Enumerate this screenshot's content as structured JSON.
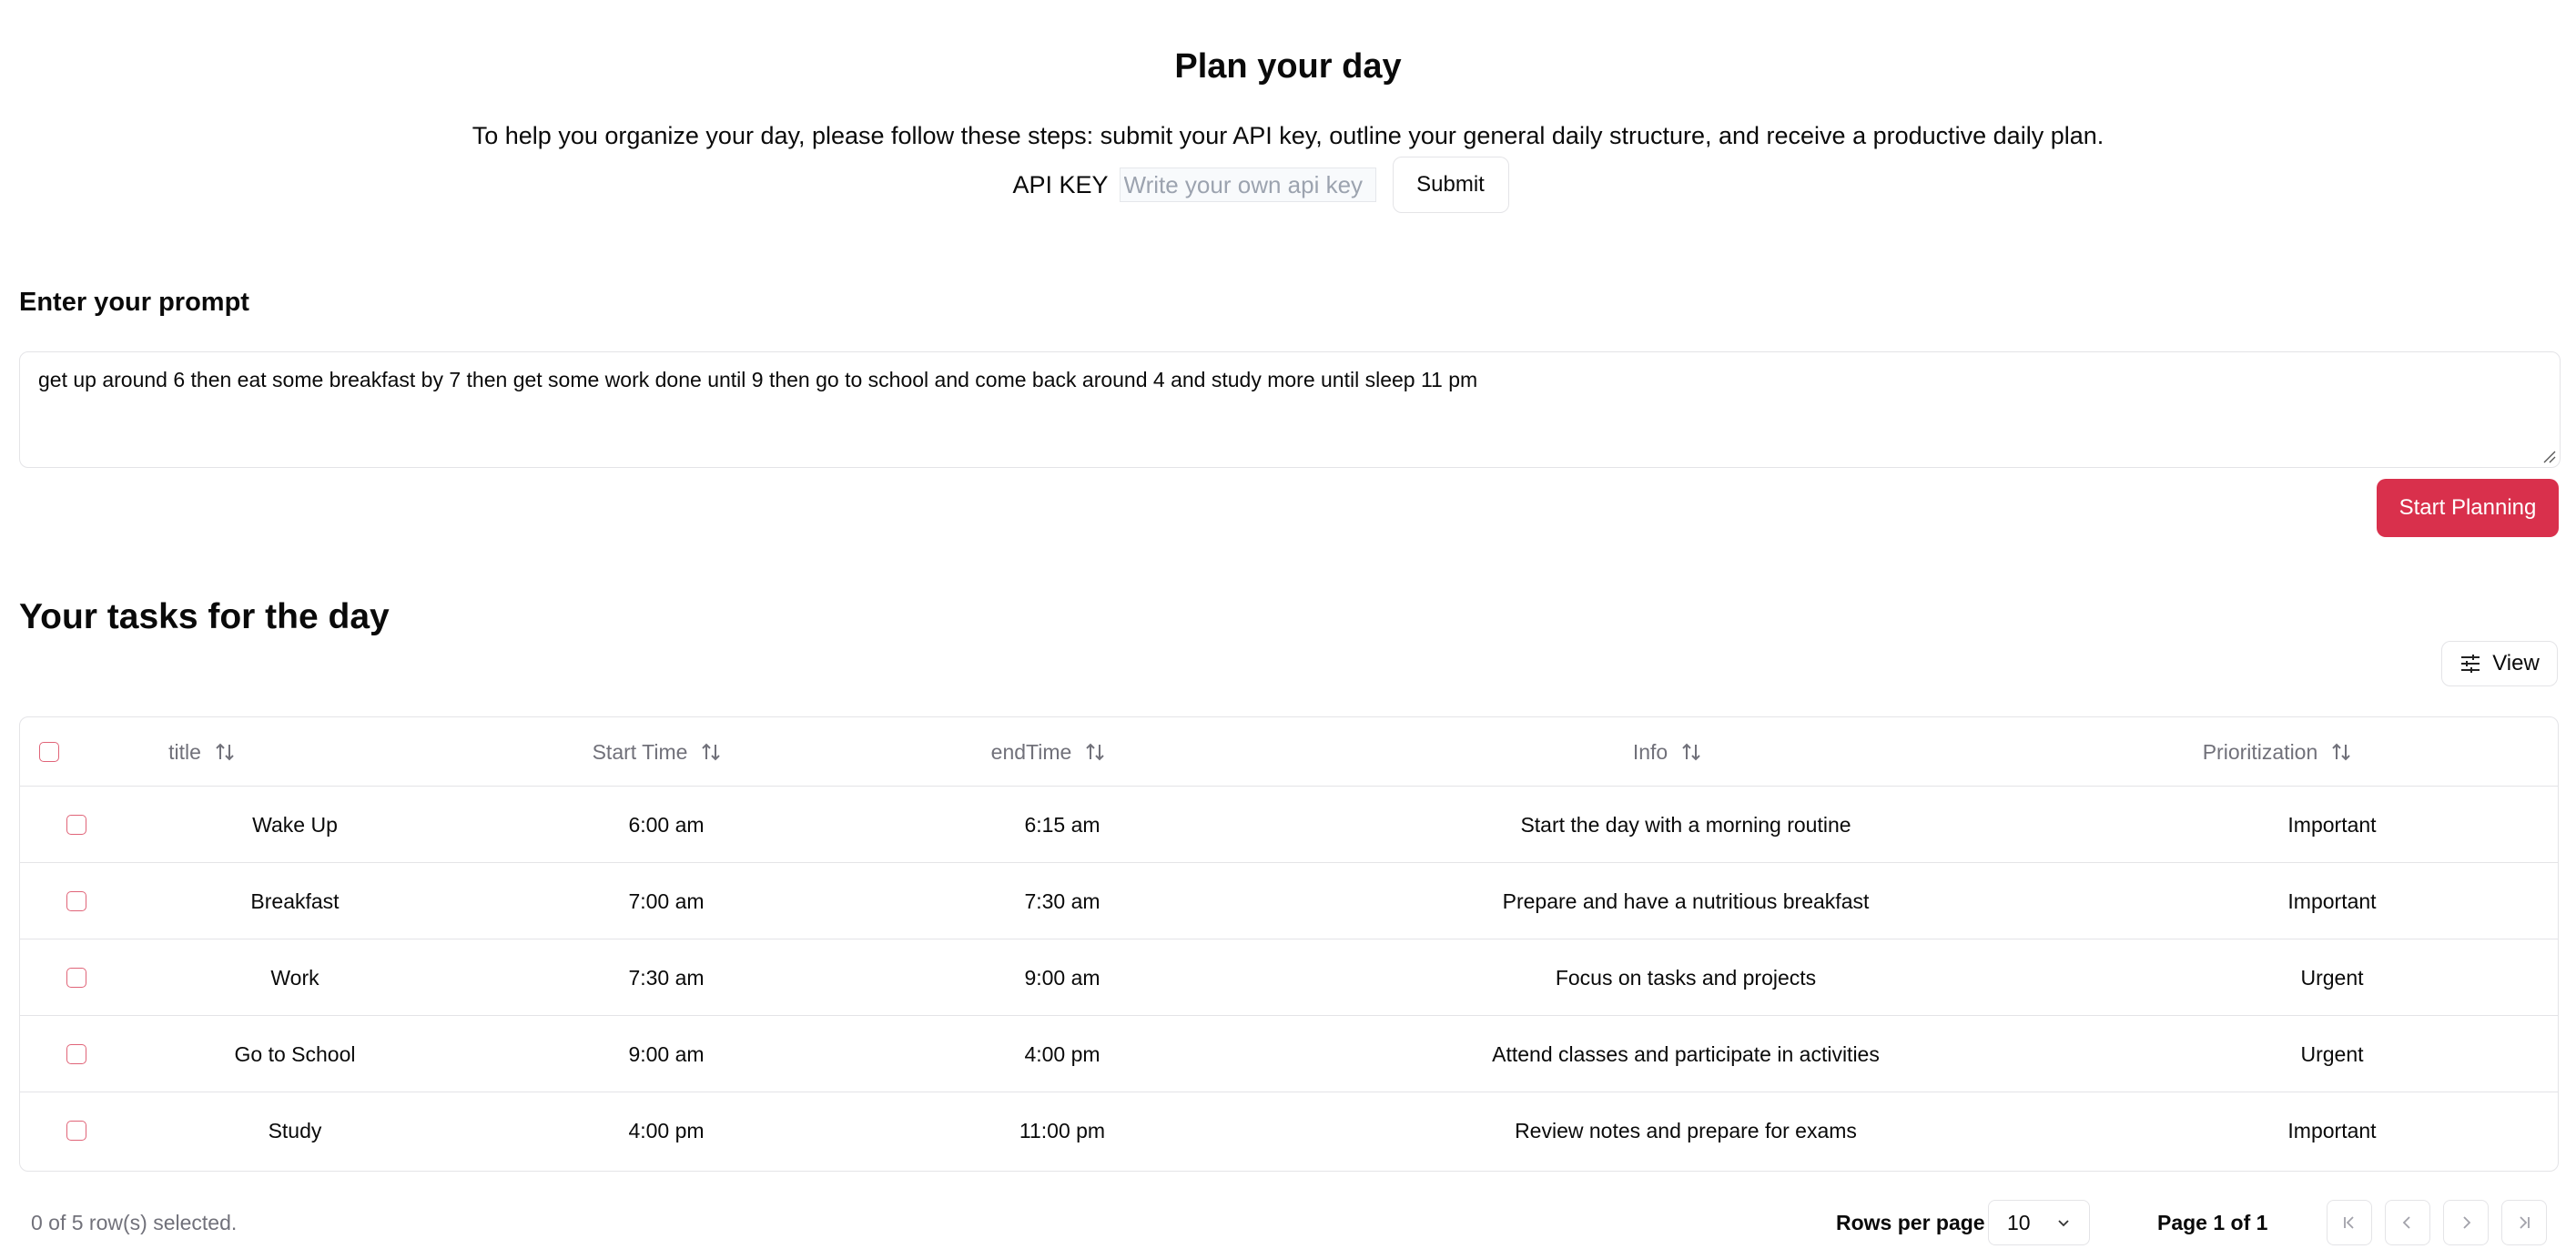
{
  "header": {
    "title": "Plan your day",
    "intro": "To help you organize your day, please follow these steps: submit your API key, outline your general daily structure, and receive a productive daily plan.",
    "api_label": "API KEY",
    "api_placeholder": "Write your own api key",
    "api_value": "",
    "submit_label": "Submit"
  },
  "prompt": {
    "label": "Enter your prompt",
    "value": "get up around 6 then eat some breakfast by 7 then get some work done until 9 then go to school and come back around 4 and study more until sleep 11 pm",
    "start_label": "Start Planning"
  },
  "tasks": {
    "title": "Your tasks for the day",
    "view_label": "View",
    "columns": [
      "title",
      "Start Time",
      "endTime",
      "Info",
      "Prioritization"
    ],
    "rows": [
      {
        "title": "Wake Up",
        "start": "6:00 am",
        "end": "6:15 am",
        "info": "Start the day with a morning routine",
        "priority": "Important"
      },
      {
        "title": "Breakfast",
        "start": "7:00 am",
        "end": "7:30 am",
        "info": "Prepare and have a nutritious breakfast",
        "priority": "Important"
      },
      {
        "title": "Work",
        "start": "7:30 am",
        "end": "9:00 am",
        "info": "Focus on tasks and projects",
        "priority": "Urgent"
      },
      {
        "title": "Go to School",
        "start": "9:00 am",
        "end": "4:00 pm",
        "info": "Attend classes and participate in activities",
        "priority": "Urgent"
      },
      {
        "title": "Study",
        "start": "4:00 pm",
        "end": "11:00 pm",
        "info": "Review notes and prepare for exams",
        "priority": "Important"
      }
    ]
  },
  "footer": {
    "selected": "0 of 5 row(s) selected.",
    "rows_per_page_label": "Rows per page",
    "rows_per_page_value": "10",
    "page_info": "Page 1 of 1"
  },
  "colors": {
    "accent": "#d9304c",
    "checkbox": "#e06478",
    "muted": "#71717a",
    "border": "#e4e4e7"
  }
}
